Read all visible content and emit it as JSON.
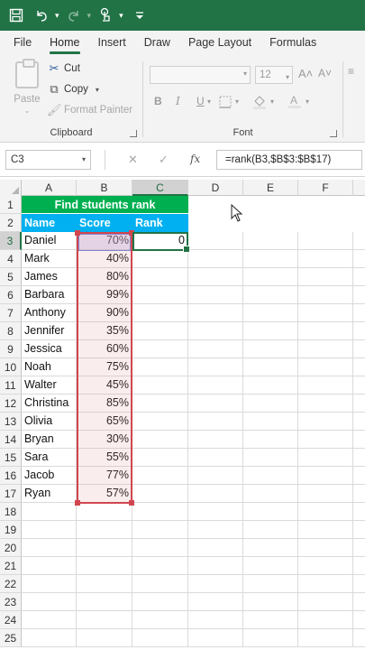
{
  "app": {
    "accent": "#217346"
  },
  "quick_access": {
    "icons": [
      "save-icon",
      "undo-icon",
      "redo-icon",
      "touch-mode-icon",
      "customize-icon"
    ]
  },
  "menu": {
    "tabs": [
      "File",
      "Home",
      "Insert",
      "Draw",
      "Page Layout",
      "Formulas"
    ],
    "active": "Home"
  },
  "ribbon": {
    "clipboard": {
      "paste_label": "Paste",
      "cut_label": "Cut",
      "copy_label": "Copy",
      "format_painter_label": "Format Painter",
      "group_label": "Clipboard"
    },
    "font": {
      "size_value": "12",
      "grow_label": "A˄",
      "shrink_label": "A˅",
      "bold_label": "B",
      "italic_label": "I",
      "underline_label": "U",
      "group_label": "Font"
    }
  },
  "formula_bar": {
    "name_box": "C3",
    "formula": "=rank(B3,$B$3:$B$17)"
  },
  "sheet": {
    "columns": [
      "A",
      "B",
      "C",
      "D",
      "E",
      "F"
    ],
    "rows": [
      "1",
      "2",
      "3",
      "4",
      "5",
      "6",
      "7",
      "8",
      "9",
      "10",
      "11",
      "12",
      "13",
      "14",
      "15",
      "16",
      "17",
      "18",
      "19",
      "20",
      "21",
      "22",
      "23",
      "24",
      "25"
    ],
    "selected_column": "C",
    "selected_row": "3",
    "title": "Find students rank",
    "headers": {
      "name": "Name",
      "score": "Score",
      "rank": "Rank"
    },
    "colors": {
      "title_fill": "#00b050",
      "header_fill": "#00b0f0",
      "range_border": "#d2464f"
    },
    "students": [
      {
        "name": "Daniel",
        "score": "70%",
        "rank": "0"
      },
      {
        "name": "Mark",
        "score": "40%",
        "rank": ""
      },
      {
        "name": "James",
        "score": "80%",
        "rank": ""
      },
      {
        "name": "Barbara",
        "score": "99%",
        "rank": ""
      },
      {
        "name": "Anthony",
        "score": "90%",
        "rank": ""
      },
      {
        "name": "Jennifer",
        "score": "35%",
        "rank": ""
      },
      {
        "name": "Jessica",
        "score": "60%",
        "rank": ""
      },
      {
        "name": "Noah",
        "score": "75%",
        "rank": ""
      },
      {
        "name": "Walter",
        "score": "45%",
        "rank": ""
      },
      {
        "name": "Christina",
        "score": "85%",
        "rank": ""
      },
      {
        "name": "Olivia",
        "score": "65%",
        "rank": ""
      },
      {
        "name": "Bryan",
        "score": "30%",
        "rank": ""
      },
      {
        "name": "Sara",
        "score": "55%",
        "rank": ""
      },
      {
        "name": "Jacob",
        "score": "77%",
        "rank": ""
      },
      {
        "name": "Ryan",
        "score": "57%",
        "rank": ""
      }
    ]
  }
}
